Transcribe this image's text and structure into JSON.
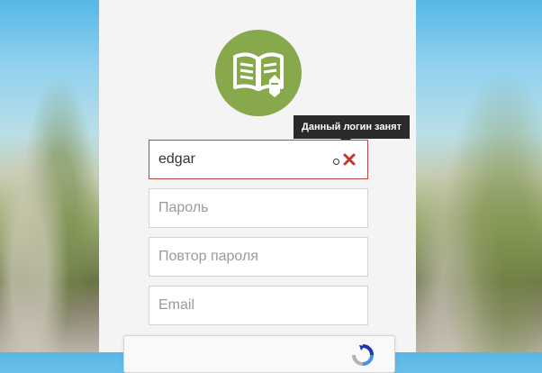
{
  "form": {
    "login": {
      "value": "edgar",
      "placeholder": ""
    },
    "password": {
      "placeholder": "Пароль"
    },
    "password_repeat": {
      "placeholder": "Повтор пароля"
    },
    "email": {
      "placeholder": "Email"
    }
  },
  "tooltip": {
    "text": "Данный логин занят"
  },
  "colors": {
    "logo_green": "#87a94b",
    "error_red": "#c0392b",
    "tooltip_bg": "#2a2a2a"
  },
  "icons": {
    "logo": "book-pencil-icon",
    "error": "close-x-icon",
    "captcha": "recaptcha-icon"
  }
}
